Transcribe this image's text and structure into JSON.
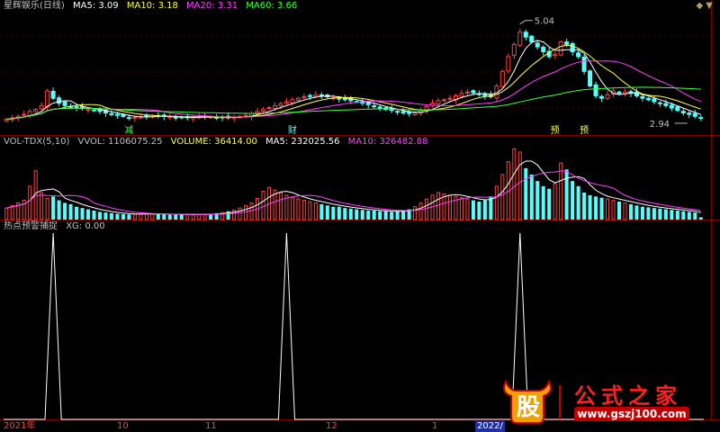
{
  "colors": {
    "up": "#ff4040",
    "down": "#54ffff",
    "ma5": "#ffffff",
    "ma10": "#ffff40",
    "ma20": "#ff40ff",
    "ma60": "#40ff40",
    "grid": "#800000",
    "text": "#c0c0c0"
  },
  "kline": {
    "title": "星辉娱乐(日线)",
    "legend": [
      {
        "label": "MA5: 3.09",
        "color": "#ffffff"
      },
      {
        "label": "MA10: 3.18",
        "color": "#ffff40"
      },
      {
        "label": "MA20: 3.31",
        "color": "#ff40ff"
      },
      {
        "label": "MA60: 3.66",
        "color": "#40ff40"
      }
    ],
    "high_label": "5.04",
    "low_label": "2.94",
    "markers": [
      {
        "text": "减",
        "color": "#40ff40"
      },
      {
        "text": "财",
        "color": "#54ffff"
      },
      {
        "text": "预",
        "color": "#ffff40"
      },
      {
        "text": "预",
        "color": "#ffff40"
      }
    ]
  },
  "volume": {
    "legend": [
      {
        "label": "VOL-TDX(5,10)",
        "color": "#c0c0c0"
      },
      {
        "label": "VVOL: 1106075.25",
        "color": "#c0c0c0"
      },
      {
        "label": "VOLUME: 36414.00",
        "color": "#ffff40"
      },
      {
        "label": "MA5: 232025.56",
        "color": "#ffffff"
      },
      {
        "label": "MA10: 326482.88",
        "color": "#ff40ff"
      }
    ]
  },
  "indicator": {
    "legend": [
      {
        "label": "热点预警捕捉",
        "color": "#c0c0c0"
      },
      {
        "label": "XG: 0.00",
        "color": "#c0c0c0"
      }
    ]
  },
  "x_axis": {
    "ticks": [
      "2021年",
      "10",
      "11",
      "12",
      "1",
      "2022/"
    ]
  },
  "watermark": {
    "brand_mark": "股",
    "brand_name": "公式之家",
    "url": "www.gszj100.com"
  },
  "chart_data": [
    {
      "type": "line",
      "title": "星辉娱乐(日线)",
      "xlabel": "",
      "ylabel": "",
      "x": "trading days 1-120",
      "ylim": [
        2.7,
        5.2
      ],
      "close": [
        3.02,
        3.05,
        3.08,
        3.12,
        3.18,
        3.22,
        3.3,
        3.6,
        3.45,
        3.35,
        3.3,
        3.28,
        3.26,
        3.24,
        3.22,
        3.2,
        3.18,
        3.15,
        3.12,
        3.1,
        3.08,
        3.05,
        3.06,
        3.07,
        3.08,
        3.1,
        3.09,
        3.08,
        3.07,
        3.06,
        3.05,
        3.05,
        3.06,
        3.07,
        3.08,
        3.07,
        3.06,
        3.06,
        3.05,
        3.06,
        3.08,
        3.1,
        3.14,
        3.18,
        3.22,
        3.26,
        3.3,
        3.34,
        3.38,
        3.42,
        3.45,
        3.48,
        3.5,
        3.52,
        3.5,
        3.48,
        3.46,
        3.44,
        3.42,
        3.4,
        3.38,
        3.35,
        3.32,
        3.28,
        3.25,
        3.22,
        3.2,
        3.18,
        3.15,
        3.14,
        3.15,
        3.2,
        3.28,
        3.35,
        3.4,
        3.42,
        3.45,
        3.5,
        3.55,
        3.58,
        3.56,
        3.54,
        3.5,
        3.48,
        3.7,
        4.0,
        4.3,
        4.55,
        4.8,
        4.7,
        4.6,
        4.5,
        4.4,
        4.3,
        4.35,
        4.6,
        4.55,
        4.4,
        4.3,
        4.0,
        3.7,
        3.5,
        3.45,
        3.52,
        3.6,
        3.55,
        3.58,
        3.55,
        3.5,
        3.45,
        3.42,
        3.38,
        3.35,
        3.3,
        3.25,
        3.2,
        3.15,
        3.12,
        3.08,
        3.05
      ],
      "high": 5.04,
      "low": 2.94,
      "last_ma": {
        "MA5": 3.09,
        "MA10": 3.18,
        "MA20": 3.31,
        "MA60": 3.66
      }
    },
    {
      "type": "bar",
      "title": "VOL-TDX(5,10)",
      "last_volume": 36414.0,
      "last_ma5": 232025.56,
      "last_ma10": 326482.88,
      "vvol": 1106075.25,
      "ylim": [
        0,
        1106075.25
      ],
      "values": [
        180000,
        220000,
        260000,
        300000,
        520000,
        760000,
        420000,
        330000,
        360000,
        300000,
        260000,
        240000,
        200000,
        180000,
        160000,
        140000,
        120000,
        110000,
        100000,
        90000,
        85000,
        80000,
        85000,
        90000,
        95000,
        90000,
        85000,
        80000,
        75000,
        80000,
        85000,
        80000,
        75000,
        80000,
        85000,
        90000,
        100000,
        110000,
        130000,
        150000,
        180000,
        220000,
        260000,
        330000,
        440000,
        500000,
        460000,
        420000,
        380000,
        340000,
        320000,
        300000,
        280000,
        260000,
        240000,
        220000,
        200000,
        200000,
        180000,
        170000,
        160000,
        150000,
        140000,
        140000,
        130000,
        130000,
        120000,
        130000,
        140000,
        160000,
        200000,
        260000,
        320000,
        380000,
        420000,
        400000,
        380000,
        360000,
        340000,
        320000,
        300000,
        280000,
        300000,
        360000,
        520000,
        700000,
        900000,
        1100000,
        1050000,
        800000,
        700000,
        600000,
        520000,
        480000,
        560000,
        880000,
        780000,
        600000,
        520000,
        420000,
        380000,
        360000,
        340000,
        320000,
        300000,
        280000,
        260000,
        240000,
        220000,
        200000,
        190000,
        180000,
        170000,
        160000,
        150000,
        140000,
        130000,
        120000,
        110000,
        36414
      ]
    },
    {
      "type": "line",
      "title": "热点预警捕捉",
      "series": [
        {
          "name": "XG",
          "values": [
            0,
            0,
            0,
            0,
            0,
            0,
            0,
            0,
            0,
            0,
            0,
            0,
            0,
            0,
            0,
            0,
            0,
            0,
            0,
            0,
            0,
            0,
            0,
            0,
            0,
            0,
            0,
            0,
            0,
            0,
            0,
            0,
            0,
            0,
            0,
            0,
            0,
            0,
            0,
            0,
            0,
            0,
            0,
            0,
            0,
            0,
            0,
            0,
            0,
            0,
            0,
            0,
            0,
            0,
            0,
            0,
            0,
            0,
            0,
            0,
            0,
            0,
            0,
            0,
            0,
            0,
            0,
            0,
            0,
            0,
            0,
            0,
            0,
            0,
            0,
            0,
            0,
            0,
            0,
            0,
            0,
            0,
            0,
            0,
            0,
            0,
            0,
            0,
            0,
            0,
            0,
            0,
            0,
            0,
            0,
            0,
            0,
            0,
            0,
            0,
            0,
            0,
            0,
            0,
            0,
            0,
            0,
            0,
            0,
            0,
            0,
            0,
            0,
            0,
            0,
            0,
            0,
            0,
            0,
            0
          ]
        }
      ],
      "spikes_at": [
        8,
        48,
        88
      ],
      "last": 0.0
    }
  ]
}
